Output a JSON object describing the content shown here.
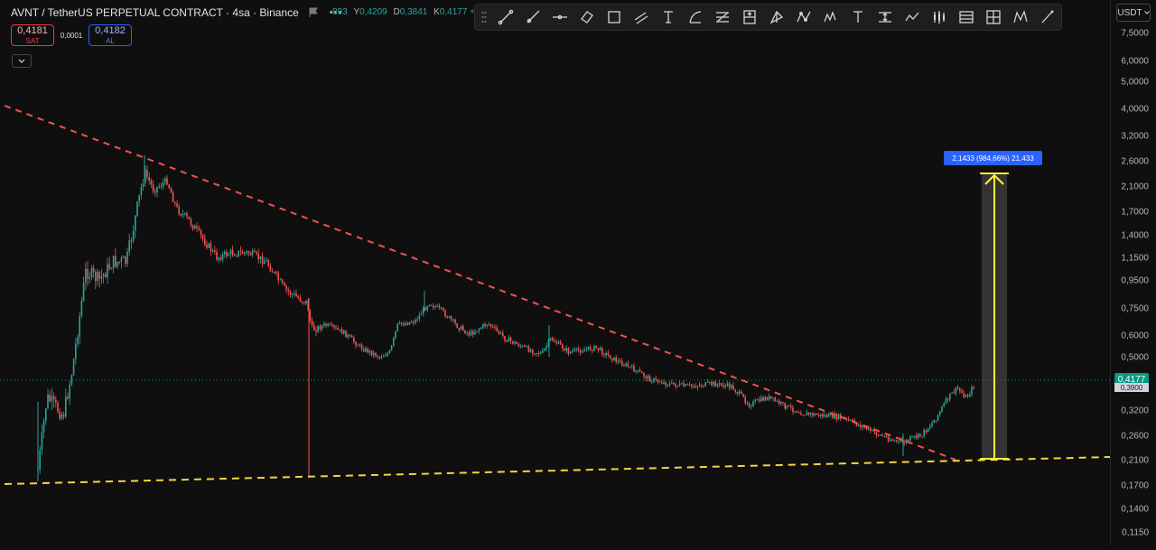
{
  "legend": {
    "title": "AVNT / TetherUS PERPETUAL CONTRACT · 4sa · Binance",
    "more": "•••",
    "ohlc": {
      "o_value": "893",
      "h_label": "Y",
      "h_value": "0,4209",
      "l_label": "D",
      "l_value": "0,3841",
      "c_label": "K",
      "c_value": "0,4177",
      "change": "+0"
    }
  },
  "trade": {
    "sell_price": "0,4181",
    "sell_label": "SAT",
    "spread": "0,0001",
    "buy_price": "0,4182",
    "buy_label": "AL"
  },
  "currency": {
    "value": "USDT"
  },
  "price_axis": {
    "ticks": [
      "7,5000",
      "6,0000",
      "5,0000",
      "4,0000",
      "3,2000",
      "2,6000",
      "2,1000",
      "1,7000",
      "1,4000",
      "1,1500",
      "0,9500",
      "0,7500",
      "0,6000",
      "0,5000",
      "0,3200",
      "0,2600",
      "0,2100",
      "0,1700",
      "0,1400",
      "0,1150"
    ],
    "last_price": "0,4177",
    "prev_close": "0,3900"
  },
  "measure": {
    "label": "2,1433 (984,66%) 21.433"
  },
  "toolbar": {
    "tools": [
      "trend-line-icon",
      "ray-icon",
      "horizontal-line-icon",
      "rotated-rectangle-icon",
      "rectangle-icon",
      "parallel-channel-icon",
      "text-icon",
      "curve-icon",
      "fib-retracement-icon",
      "long-position-icon",
      "pitchfork-icon",
      "path-icon",
      "pattern-icon",
      "text-note-icon",
      "price-range-icon",
      "projection-icon",
      "candles-icon",
      "table-icon",
      "grid-icon",
      "xabcd-pattern-icon",
      "brush-icon"
    ]
  },
  "colors": {
    "background": "#0f0f0f",
    "up": "#26a69a",
    "down": "#ef5350",
    "trend_resistance": "#ef5350",
    "trend_support": "#f5d442",
    "measure_arrow": "#fff33a",
    "measure_label_bg": "#2962ff"
  }
}
